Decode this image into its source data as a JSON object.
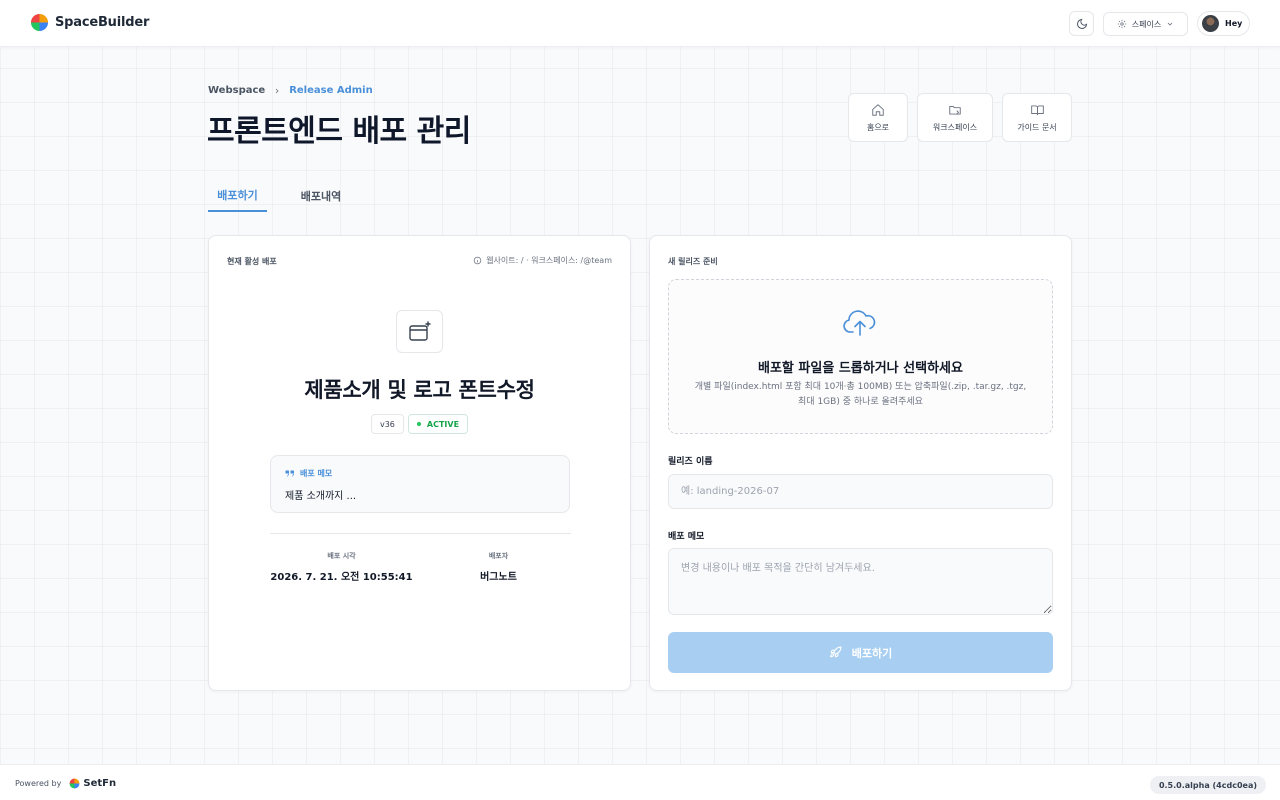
{
  "header": {
    "brand_name": "SpaceBuilder",
    "space_select_label": "스페이스",
    "user_name": "Hey"
  },
  "breadcrumb": {
    "items": [
      "Webspace",
      "Release Admin"
    ]
  },
  "page": {
    "title": "프론트엔드 배포 관리"
  },
  "quick_links": [
    {
      "label": "홈으로",
      "icon": "home-icon"
    },
    {
      "label": "워크스페이스",
      "icon": "folder-icon"
    },
    {
      "label": "가이드 문서",
      "icon": "book-icon"
    }
  ],
  "tabs": [
    {
      "label": "배포하기",
      "active": true
    },
    {
      "label": "배포내역",
      "active": false
    }
  ],
  "current_release": {
    "section_label": "현재 활성 배포",
    "meta": "웹사이트: / · 워크스페이스: /@team",
    "title": "제품소개 및 로고 폰트수정",
    "version": "v36",
    "status": "ACTIVE",
    "memo_label": "배포 메모",
    "memo_text": "제품 소개까지 ...",
    "deploy_time_label": "배포 시각",
    "deploy_time": "2026. 7. 21. 오전 10:55:41",
    "deployer_label": "배포자",
    "deployer": "버그노트"
  },
  "new_release": {
    "section_label": "새 릴리즈 준비",
    "drop_title": "배포할 파일을 드롭하거나 선택하세요",
    "drop_desc": "개별 파일(index.html 포함 최대 10개·총 100MB) 또는 압축파일(.zip, .tar.gz, .tgz, 최대 1GB) 중 하나로 올려주세요",
    "name_label": "릴리즈 이름",
    "name_value": "",
    "name_placeholder": "예: landing-2026-07",
    "memo_label": "배포 메모",
    "memo_value": "",
    "memo_placeholder": "변경 내용이나 배포 목적을 간단히 남겨두세요.",
    "deploy_button": "배포하기"
  },
  "footer": {
    "powered_by": "Powered by",
    "vendor": "SetFn",
    "version": "0.5.0.alpha (4cdc0ea)"
  },
  "colors": {
    "accent": "#4a90d9",
    "deploy_button_disabled": "#a8cff1",
    "active_status": "#16a34a"
  }
}
